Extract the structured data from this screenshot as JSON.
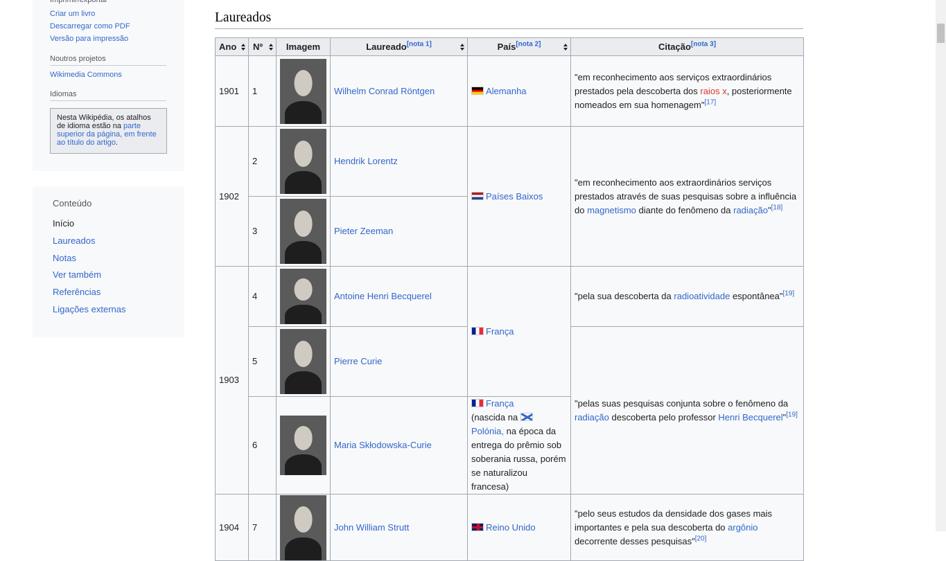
{
  "sidebar": {
    "print_heading": "Imprimir/exportar",
    "print_items": [
      "Criar um livro",
      "Descarregar como PDF",
      "Versão para impressão"
    ],
    "projects_heading": "Noutros projetos",
    "projects_items": [
      "Wikimedia Commons"
    ],
    "languages_heading": "Idiomas",
    "lang_notice": {
      "text_before": "Nesta Wikipédia, os atalhos de idioma estão na ",
      "link": "parte superior da página, em frente ao título do artigo",
      "text_after": "."
    }
  },
  "toc": {
    "heading": "Conteúdo",
    "items": [
      "Início",
      "Laureados",
      "Notas",
      "Ver também",
      "Referências",
      "Ligações externas"
    ]
  },
  "section": {
    "title": "Laureados"
  },
  "table": {
    "headers": {
      "year": "Ano",
      "number": "Nº",
      "image": "Imagem",
      "laureate": "Laureado",
      "laureate_note": "[nota 1]",
      "country": "País",
      "country_note": "[nota 2]",
      "citation": "Citação",
      "citation_note": "[nota 3]"
    },
    "rows": [
      {
        "year": "1901",
        "number": "1",
        "laureate": "Wilhelm Conrad Röntgen",
        "country": "Alemanha",
        "citation_a": "\"em reconhecimento aos serviços extraordinários prestados pela descoberta dos ",
        "citation_link": "raios x",
        "citation_b": ", posteriormente nomeados em sua homenagem\"",
        "citation_ref": "[17]"
      },
      {
        "year": "1902",
        "number": "2",
        "laureate": "Hendrik Lorentz",
        "country": "Países Baixos",
        "citation_a": "\"em reconhecimento aos extraordinários serviços prestados através de suas pesquisas sobre a influência do ",
        "citation_link1": "magnetismo",
        "citation_b": " diante do fenômeno da ",
        "citation_link2": "radiação",
        "citation_c": "\"",
        "citation_ref": "[18]"
      },
      {
        "number": "3",
        "laureate": "Pieter Zeeman"
      },
      {
        "year": "1903",
        "number": "4",
        "laureate": "Antoine Henri Becquerel",
        "country": "França",
        "citation_a": "\"pela sua descoberta da ",
        "citation_link": "radioatividade",
        "citation_b": " espontânea\"",
        "citation_ref": "[19]"
      },
      {
        "number": "5",
        "laureate": "Pierre Curie",
        "citation_a": "\"pelas suas pesquisas conjunta sobre o fenômeno da ",
        "citation_link1": "radiação",
        "citation_b": " descoberta pelo professor ",
        "citation_link2": "Henri Becquerel",
        "citation_c": "\"",
        "citation_ref": "[19]"
      },
      {
        "number": "6",
        "laureate": "Maria Skłodowska-Curie",
        "country": "França",
        "born_a": "(nascida na ",
        "born_link": "Polónia,",
        "born_b": " na época da entrega do prêmio sob soberania russa, porém se naturalizou francesa)"
      },
      {
        "year": "1904",
        "number": "7",
        "laureate": "John William Strutt",
        "country": "Reino Unido",
        "citation_a": "\"pelo seus estudos da densidade dos gases mais importantes e pela sua descoberta do ",
        "citation_link": "argônio",
        "citation_b": " decorrente desses pesquisas\"",
        "citation_ref": "[20]"
      }
    ]
  },
  "colors": {
    "link": "#3366cc",
    "redlink": "#dd3333",
    "header_bg": "#eaecf0",
    "cell_bg": "#f8f9fa",
    "border": "#a2a9b1"
  }
}
